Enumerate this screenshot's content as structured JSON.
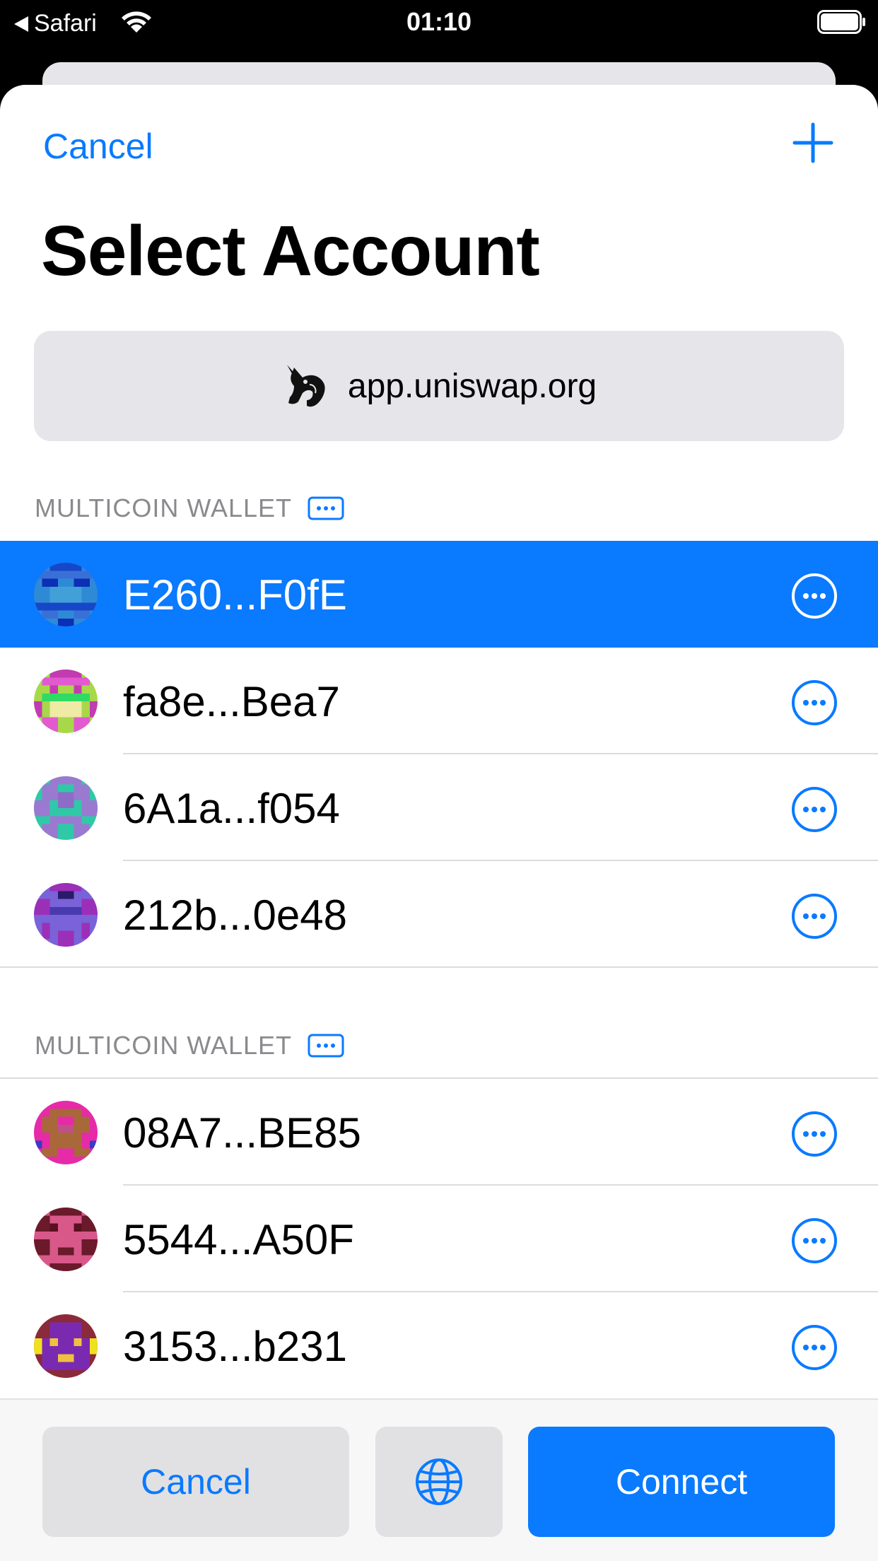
{
  "status_bar": {
    "back_app": "Safari",
    "time": "01:10"
  },
  "nav": {
    "cancel_label": "Cancel",
    "add_icon": "plus-icon"
  },
  "title": "Select Account",
  "site": {
    "domain": "app.uniswap.org",
    "icon": "uniswap-unicorn-logo"
  },
  "sections": [
    {
      "header": "MULTICOIN WALLET",
      "header_icon": "ellipsis-badge-icon",
      "accounts": [
        {
          "address": "E260...F0fE",
          "selected": true
        },
        {
          "address": "fa8e...Bea7",
          "selected": false
        },
        {
          "address": "6A1a...f054",
          "selected": false
        },
        {
          "address": "212b...0e48",
          "selected": false
        }
      ]
    },
    {
      "header": "MULTICOIN WALLET",
      "header_icon": "ellipsis-badge-icon",
      "accounts": [
        {
          "address": "08A7...BE85",
          "selected": false
        },
        {
          "address": "5544...A50F",
          "selected": false
        },
        {
          "address": "3153...b231",
          "selected": false
        }
      ]
    }
  ],
  "bottom": {
    "cancel_label": "Cancel",
    "globe_icon": "globe-icon",
    "connect_label": "Connect"
  },
  "colors": {
    "accent": "#0a7aff",
    "selected_row": "#0a7aff",
    "secondary_text": "#8a8a8e"
  }
}
